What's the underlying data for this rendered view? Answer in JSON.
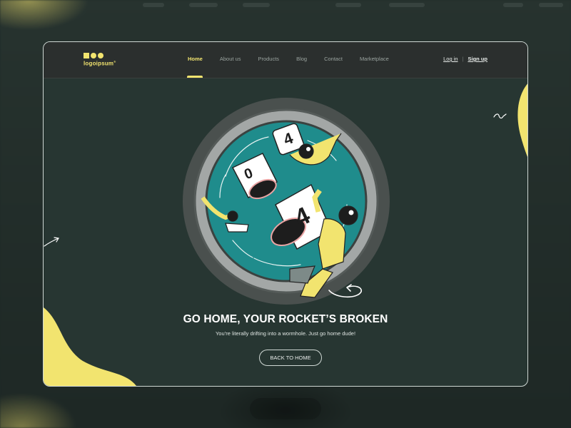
{
  "brand": {
    "name": "logoipsum",
    "trademark": "®"
  },
  "nav": {
    "items": [
      {
        "label": "Home",
        "active": true
      },
      {
        "label": "About us"
      },
      {
        "label": "Products"
      },
      {
        "label": "Blog"
      },
      {
        "label": "Contact"
      },
      {
        "label": "Marketplace"
      }
    ]
  },
  "auth": {
    "login": "Log in",
    "separator": "|",
    "signup": "Sign up"
  },
  "hero": {
    "title": "GO HOME, YOUR ROCKET’S BROKEN",
    "subtitle": "You’re literally drifting into a wormhole. Just go home dude!",
    "button": "BACK TO HOME",
    "digits": [
      "4",
      "0",
      "4"
    ]
  },
  "colors": {
    "accent": "#f2e46f",
    "background": "#273632",
    "topbar": "#2b2f2e",
    "portal": "#1f8c8c"
  }
}
